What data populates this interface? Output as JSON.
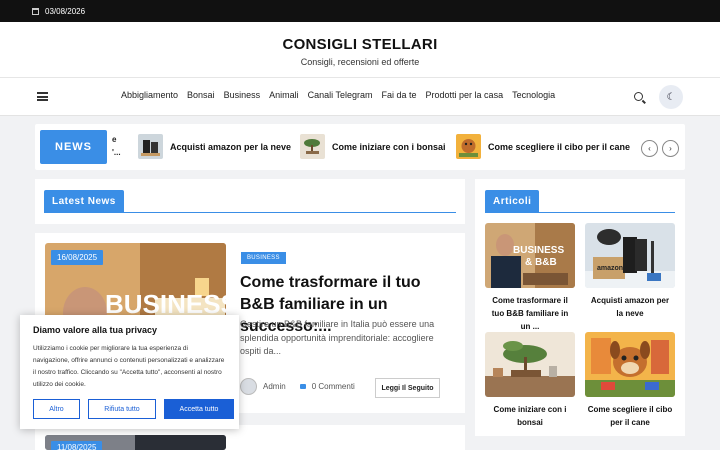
{
  "topbar": {
    "date": "03/08/2026",
    "calendar_icon": "calendar-icon"
  },
  "site": {
    "title": "CONSIGLI STELLARI",
    "tagline": "Consigli, recensioni ed offerte"
  },
  "nav": {
    "menu_icon": "hamburger-icon",
    "items": [
      "Abbigliamento",
      "Bonsai",
      "Business",
      "Animali",
      "Canali Telegram",
      "Fai da te",
      "Prodotti per la casa",
      "Tecnologia"
    ],
    "search_icon": "search-icon",
    "dark_mode_icon": "moon-icon"
  },
  "ticker": {
    "label": "NEWS",
    "fragment_line1": "e",
    "fragment_line2": "'...",
    "items": [
      "Acquisti amazon per la neve",
      "Come iniziare con i bonsai",
      "Come scegliere il cibo per il cane"
    ],
    "prev_icon": "chevron-left-icon",
    "next_icon": "chevron-right-icon"
  },
  "latest": {
    "title": "Latest News",
    "post": {
      "date": "16/08/2025",
      "image_text": "BUSINESS",
      "category": "BUSINESS",
      "title": "Come trasformare il tuo B&B familiare in un successo:...",
      "excerpt": "Gestire un B&B familiare in Italia può essere una splendida opportunità imprenditoriale: accogliere ospiti da...",
      "author": "Admin",
      "comments": "0 Commenti",
      "read_more": "Leggi Il Seguito"
    },
    "next_post": {
      "date": "11/08/2025"
    }
  },
  "sidebar": {
    "title": "Articoli",
    "cards": [
      {
        "caption": "Come trasformare il tuo B&B familiare in un ...",
        "image_text": "BUSINESS & B&B"
      },
      {
        "caption": "Acquisti amazon per la neve",
        "image_text": "amazon"
      },
      {
        "caption": "Come iniziare con i bonsai",
        "image_text": ""
      },
      {
        "caption": "Come scegliere il cibo per il cane",
        "image_text": ""
      }
    ]
  },
  "cookie": {
    "title": "Diamo valore alla tua privacy",
    "text": "Utilizziamo i cookie per migliorare la tua esperienza di navigazione, offrire annunci o contenuti personalizzati e analizzare il nostro traffico. Cliccando su \"Accetta tutto\", acconsenti al nostro utilizzo dei cookie.",
    "btn_other": "Altro",
    "btn_reject": "Rifiuta tutto",
    "btn_accept": "Accetta tutto"
  },
  "colors": {
    "accent": "#3a8ee6",
    "cookie_button": "#1a5fd6",
    "topbar": "#111111"
  }
}
